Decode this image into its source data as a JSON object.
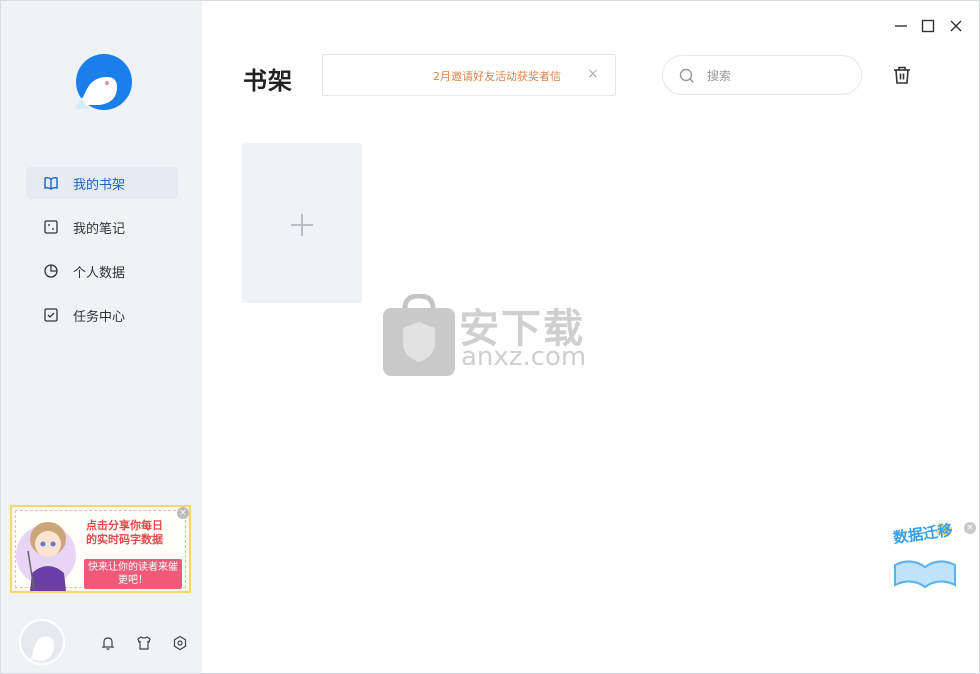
{
  "sidebar": {
    "items": [
      {
        "label": "我的书架",
        "icon": "book-icon",
        "active": true
      },
      {
        "label": "我的笔记",
        "icon": "note-icon",
        "active": false
      },
      {
        "label": "个人数据",
        "icon": "pie-chart-icon",
        "active": false
      },
      {
        "label": "任务中心",
        "icon": "task-icon",
        "active": false
      }
    ],
    "promo": {
      "line1": "点击分享你每日",
      "line2": "的实时码字数据",
      "button": "快来让你的读者来催更吧！"
    }
  },
  "header": {
    "title": "书架",
    "notice": "2月邀请好友活动获奖者信",
    "notice_close": "×",
    "search_placeholder": "搜索"
  },
  "watermark": {
    "text1": "安下载",
    "text2": "anxz.com"
  },
  "migrate_badge": {
    "text": "数据迁移",
    "close": "×"
  },
  "colors": {
    "accent": "#1a63c9",
    "sidebar_bg": "#f0f3f6",
    "notice": "#e0844a"
  }
}
